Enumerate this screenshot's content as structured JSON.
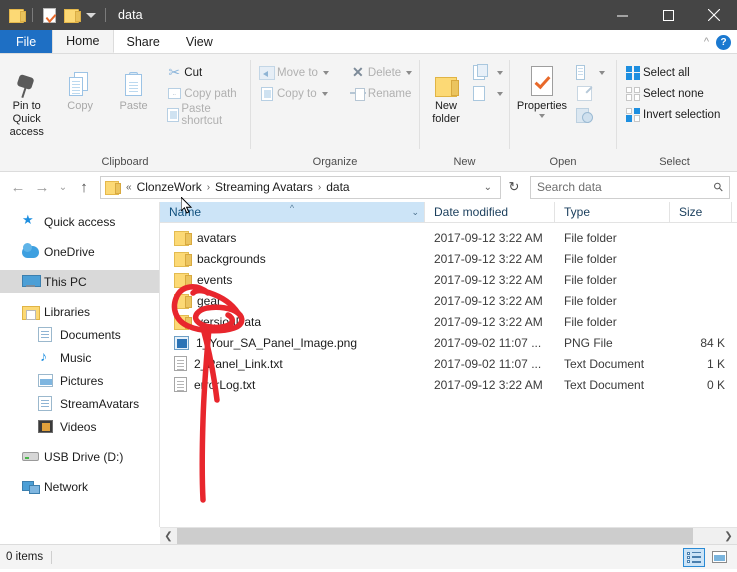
{
  "window": {
    "title": "data",
    "quick_access_icons": [
      "folder-icon",
      "properties-icon",
      "new-folder-icon",
      "customize-caret-icon"
    ],
    "controls": {
      "minimize": "minimize-icon",
      "maximize": "maximize-icon",
      "close": "close-icon"
    }
  },
  "menu": {
    "tabs": [
      {
        "label": "File",
        "id": "file"
      },
      {
        "label": "Home",
        "id": "home"
      },
      {
        "label": "Share",
        "id": "share"
      },
      {
        "label": "View",
        "id": "view"
      }
    ],
    "active_tab": "Home",
    "collapse_icon": "chevron-up-icon",
    "help_label": "?"
  },
  "ribbon": {
    "groups": [
      {
        "label": "Clipboard",
        "big_buttons": [
          {
            "label": "Pin to Quick access",
            "icon": "pin-icon",
            "enabled": true
          },
          {
            "label": "Copy",
            "icon": "copy-icon",
            "enabled": false
          },
          {
            "label": "Paste",
            "icon": "paste-icon",
            "enabled": false
          }
        ],
        "small_buttons": [
          {
            "label": "Cut",
            "icon": "scissors-icon",
            "enabled": false
          },
          {
            "label": "Copy path",
            "icon": "copy-path-icon",
            "enabled": false
          },
          {
            "label": "Paste shortcut",
            "icon": "paste-shortcut-icon",
            "enabled": false
          }
        ]
      },
      {
        "label": "Organize",
        "small_buttons": [
          {
            "label": "Move to",
            "icon": "move-to-icon",
            "enabled": false,
            "dropdown": true
          },
          {
            "label": "Copy to",
            "icon": "copy-to-icon",
            "enabled": false,
            "dropdown": true
          },
          {
            "label": "Delete",
            "icon": "delete-x-icon",
            "enabled": false,
            "dropdown": true
          },
          {
            "label": "Rename",
            "icon": "rename-icon",
            "enabled": false
          }
        ]
      },
      {
        "label": "New",
        "big_buttons": [
          {
            "label": "New folder",
            "icon": "new-folder-icon",
            "enabled": true
          }
        ],
        "small_buttons": [
          {
            "label": "",
            "icon": "new-item-icon",
            "enabled": true,
            "dropdown": true
          },
          {
            "label": "",
            "icon": "easy-access-icon",
            "enabled": true,
            "dropdown": true
          }
        ]
      },
      {
        "label": "Open",
        "big_buttons": [
          {
            "label": "Properties",
            "icon": "properties-icon",
            "enabled": true,
            "dropdown": true
          }
        ],
        "small_buttons": [
          {
            "label": "",
            "icon": "open-icon",
            "enabled": false,
            "dropdown": true
          },
          {
            "label": "",
            "icon": "edit-icon",
            "enabled": false
          },
          {
            "label": "",
            "icon": "history-icon",
            "enabled": false
          }
        ]
      },
      {
        "label": "Select",
        "small_buttons": [
          {
            "label": "Select all",
            "icon": "select-all-icon",
            "enabled": true
          },
          {
            "label": "Select none",
            "icon": "select-none-icon",
            "enabled": true
          },
          {
            "label": "Invert selection",
            "icon": "invert-selection-icon",
            "enabled": true
          }
        ]
      }
    ]
  },
  "addressbar": {
    "back_icon": "arrow-left-icon",
    "forward_icon": "arrow-right-icon",
    "recent_icon": "chevron-down-icon",
    "up_icon": "arrow-up-icon",
    "folder_icon": "folder-icon",
    "prefix": "«",
    "breadcrumbs": [
      "ClonzeWork",
      "Streaming Avatars",
      "data"
    ],
    "separator": "›",
    "dropdown_icon": "chevron-down-icon",
    "refresh_icon": "refresh-icon",
    "search": {
      "placeholder": "Search data",
      "value": "",
      "icon": "search-icon"
    }
  },
  "sidebar": {
    "items": [
      {
        "label": "Quick access",
        "icon": "quick-access-star-icon",
        "indent": false,
        "selected": false
      },
      {
        "label": "OneDrive",
        "icon": "onedrive-cloud-icon",
        "indent": false,
        "selected": false
      },
      {
        "label": "This PC",
        "icon": "this-pc-icon",
        "indent": false,
        "selected": true
      },
      {
        "label": "Libraries",
        "icon": "libraries-icon",
        "indent": false,
        "selected": false
      },
      {
        "label": "Documents",
        "icon": "documents-icon",
        "indent": true,
        "selected": false
      },
      {
        "label": "Music",
        "icon": "music-icon",
        "indent": true,
        "selected": false
      },
      {
        "label": "Pictures",
        "icon": "pictures-icon",
        "indent": true,
        "selected": false
      },
      {
        "label": "StreamAvatars",
        "icon": "streamavatars-icon",
        "indent": true,
        "selected": false
      },
      {
        "label": "Videos",
        "icon": "videos-icon",
        "indent": true,
        "selected": false
      },
      {
        "label": "USB Drive (D:)",
        "icon": "usb-drive-icon",
        "indent": false,
        "selected": false
      },
      {
        "label": "Network",
        "icon": "network-icon",
        "indent": false,
        "selected": false
      }
    ]
  },
  "filelist": {
    "columns": [
      {
        "label": "Name",
        "key": "name",
        "sorted": true,
        "sort_dir": "asc"
      },
      {
        "label": "Date modified",
        "key": "date",
        "sorted": false
      },
      {
        "label": "Type",
        "key": "type",
        "sorted": false
      },
      {
        "label": "Size",
        "key": "size",
        "sorted": false
      }
    ],
    "rows": [
      {
        "name": "avatars",
        "date": "2017-09-12 3:22 AM",
        "type": "File folder",
        "size": "",
        "icon": "folder-icon"
      },
      {
        "name": "backgrounds",
        "date": "2017-09-12 3:22 AM",
        "type": "File folder",
        "size": "",
        "icon": "folder-icon"
      },
      {
        "name": "events",
        "date": "2017-09-12 3:22 AM",
        "type": "File folder",
        "size": "",
        "icon": "folder-icon"
      },
      {
        "name": "gear",
        "date": "2017-09-12 3:22 AM",
        "type": "File folder",
        "size": "",
        "icon": "folder-icon"
      },
      {
        "name": "versionData",
        "date": "2017-09-12 3:22 AM",
        "type": "File folder",
        "size": "",
        "icon": "folder-icon"
      },
      {
        "name": "1_Your_SA_Panel_Image.png",
        "date": "2017-09-02 11:07 ...",
        "type": "PNG File",
        "size": "84 K",
        "icon": "png-file-icon"
      },
      {
        "name": "2_Panel_Link.txt",
        "date": "2017-09-02 11:07 ...",
        "type": "Text Document",
        "size": "1 K",
        "icon": "text-file-icon"
      },
      {
        "name": "errorLog.txt",
        "date": "2017-09-12 3:22 AM",
        "type": "Text Document",
        "size": "0 K",
        "icon": "text-file-icon"
      }
    ]
  },
  "annotation": {
    "color": "#e8262d",
    "shape": "ellipse-with-pointer-line",
    "target": "gear"
  },
  "scrollbar": {
    "left_arrow": "chevron-left-icon",
    "right_arrow": "chevron-right-icon"
  },
  "statusbar": {
    "item_count": "0 items",
    "views": [
      {
        "name": "details-view",
        "selected": true
      },
      {
        "name": "large-icons-view",
        "selected": false
      }
    ]
  }
}
